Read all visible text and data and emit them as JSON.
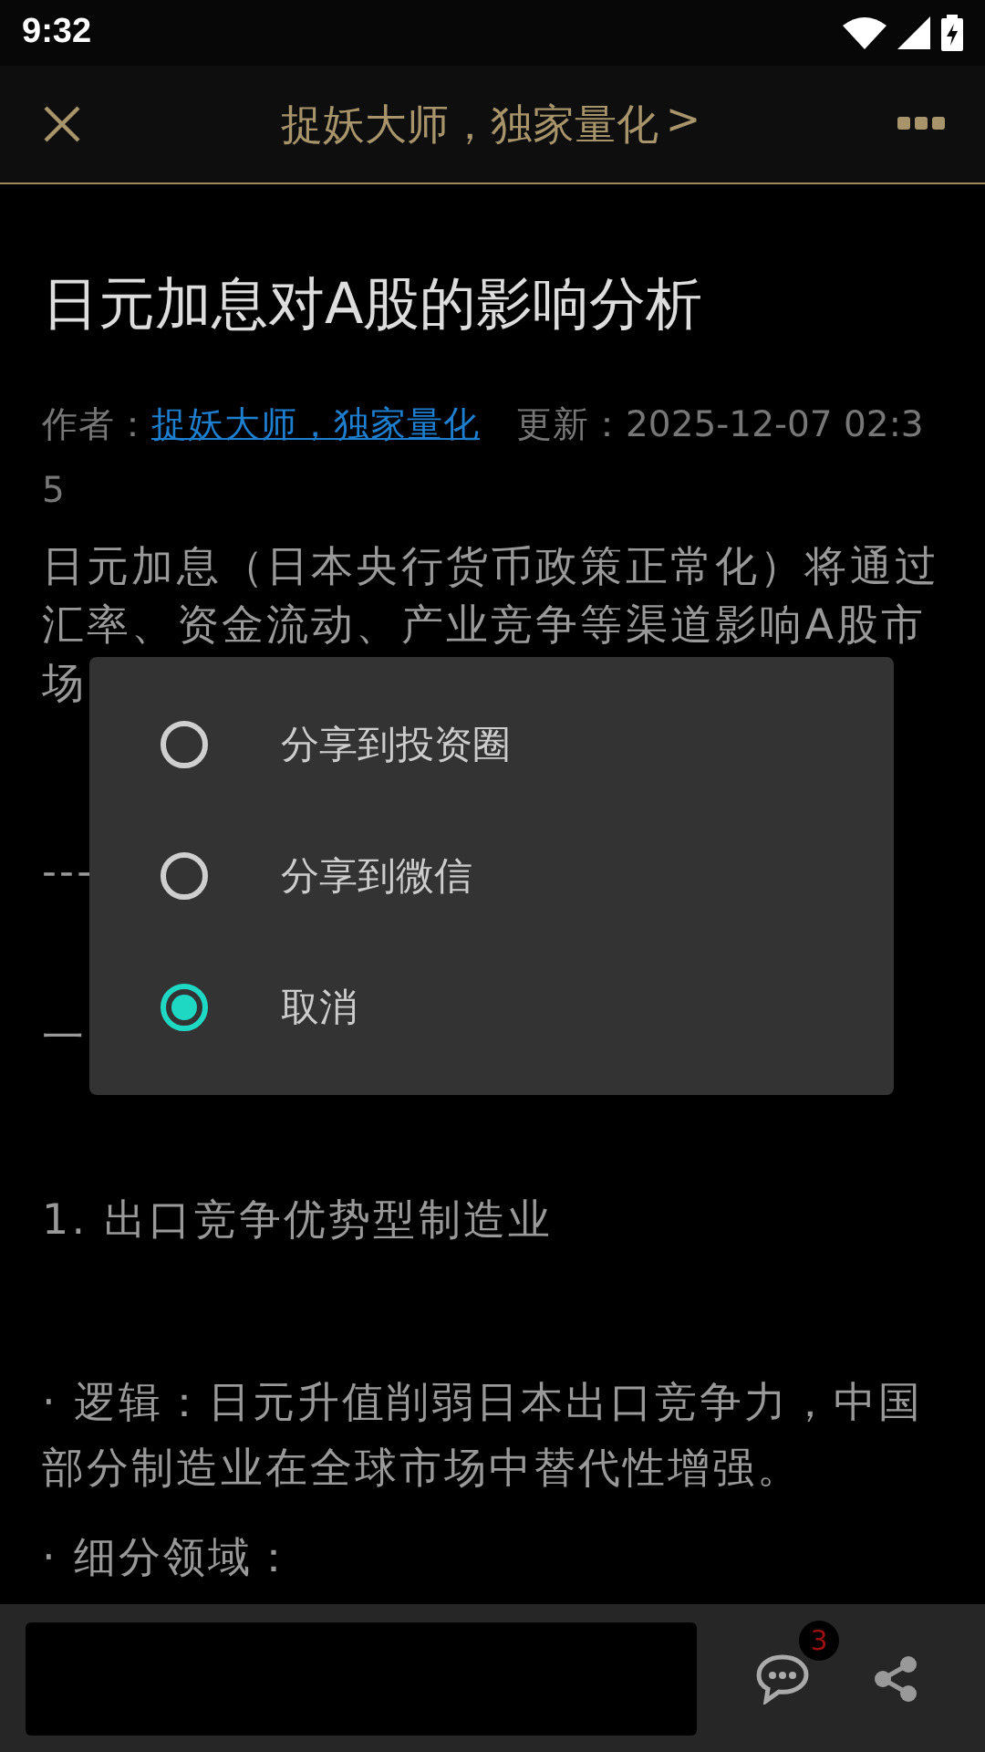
{
  "status_bar": {
    "time": "9:32"
  },
  "header": {
    "title": "捉妖大师，独家量化",
    "chevron": ">"
  },
  "article": {
    "title": "日元加息对A股的影响分析",
    "author_label": "作者：",
    "author": "捉妖大师，独家量化",
    "updated": "更新：2025-12-07 02:35",
    "blocks": [
      {
        "kind": "line",
        "text": "日元加息（日本央行货币政策正常化）将通过"
      },
      {
        "kind": "line",
        "text": "汇率、资金流动、产业竞争等渠道影响A股市"
      },
      {
        "kind": "line",
        "text": "场"
      },
      {
        "kind": "rule",
        "text": "---"
      },
      {
        "kind": "heading",
        "text": "一"
      },
      {
        "kind": "heading",
        "text": "1. 出口竞争优势型制造业"
      },
      {
        "kind": "bullet",
        "text": "· 逻辑：日元升值削弱日本出口竞争力，中国部分制造业在全球市场中替代性增强。"
      },
      {
        "kind": "bullet",
        "text": "· 细分领域："
      }
    ]
  },
  "dialog": {
    "options": [
      {
        "label": "分享到投资圈",
        "selected": false
      },
      {
        "label": "分享到微信",
        "selected": false
      },
      {
        "label": "取消",
        "selected": true
      }
    ]
  },
  "bottom_bar": {
    "comment_count": "3"
  }
}
